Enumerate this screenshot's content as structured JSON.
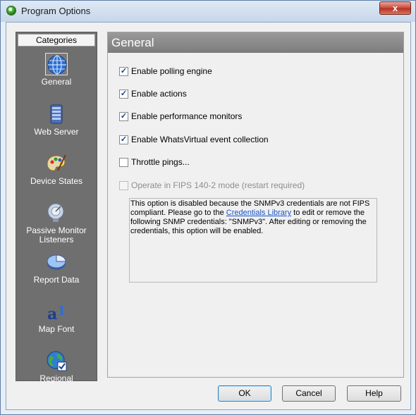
{
  "window": {
    "title": "Program Options",
    "close_glyph": "x"
  },
  "sidebar": {
    "header": "Categories",
    "items": [
      {
        "label": "General",
        "icon": "globe-icon",
        "selected": true
      },
      {
        "label": "Web Server",
        "icon": "server-icon"
      },
      {
        "label": "Device States",
        "icon": "palette-icon"
      },
      {
        "label": "Passive Monitor Listeners",
        "label_line1": "Passive Monitor",
        "label_line2": "Listeners",
        "icon": "satellite-dish-icon"
      },
      {
        "label": "Report Data",
        "icon": "pie-chart-icon"
      },
      {
        "label": "Map Font",
        "icon": "font-icon"
      },
      {
        "label": "Regional",
        "icon": "globe-check-icon"
      }
    ]
  },
  "panel": {
    "title": "General",
    "options": [
      {
        "label": "Enable polling engine",
        "checked": true,
        "disabled": false
      },
      {
        "label": "Enable actions",
        "checked": true,
        "disabled": false
      },
      {
        "label": "Enable performance monitors",
        "checked": true,
        "disabled": false
      },
      {
        "label": "Enable WhatsVirtual event collection",
        "checked": true,
        "disabled": false
      },
      {
        "label": "Throttle pings...",
        "checked": false,
        "disabled": false
      },
      {
        "label": "Operate in FIPS 140-2 mode (restart required)",
        "checked": false,
        "disabled": true
      }
    ],
    "info": {
      "text_before": "This option is disabled because the SNMPv3 credentials are not FIPS compliant. Please go to the ",
      "link": "Credentials Library",
      "text_after": " to edit or remove the following SNMP credentials: \"SNMPv3\". After editing or removing the credentials, this option will be enabled."
    }
  },
  "buttons": {
    "ok": "OK",
    "cancel": "Cancel",
    "help": "Help"
  },
  "colors": {
    "sidebar_bg": "#6f6f6f",
    "header_bg": "#8a8a8a",
    "link": "#1755c9"
  }
}
